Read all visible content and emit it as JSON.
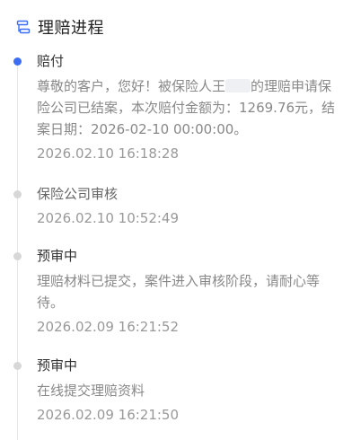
{
  "header": {
    "title": "理赔进程"
  },
  "timeline": {
    "items": [
      {
        "title": "赔付",
        "desc_part1": "尊敬的客户，您好！被保险人王",
        "desc_part2": "的理赔申请保险公司已结案，本次赔付金额为：1269.76元，结案日期：2026-02-10 00:00:00。",
        "time": "2026.02.10 16:18:28"
      },
      {
        "title": "保险公司审核",
        "time": "2026.02.10 10:52:49"
      },
      {
        "title": "预审中",
        "desc": "理赔材料已提交，案件进入审核阶段，请耐心等待。",
        "time": "2026.02.09 16:21:52"
      },
      {
        "title": "预审中",
        "desc": "在线提交理赔资料",
        "time": "2026.02.09 16:21:50"
      }
    ]
  },
  "colors": {
    "active_dot": "#3d6df2",
    "inactive_dot": "#d7d7d7",
    "line": "#e6e6e6"
  },
  "icons": {
    "header": "process-flow-icon"
  }
}
